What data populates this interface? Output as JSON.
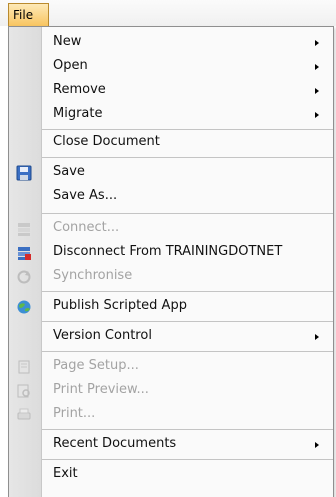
{
  "menubar": {
    "file_label": "File"
  },
  "menu": {
    "items": [
      {
        "label": "New",
        "submenu": true
      },
      {
        "label": "Open",
        "submenu": true
      },
      {
        "label": "Remove",
        "submenu": true
      },
      {
        "label": "Migrate",
        "submenu": true
      },
      {
        "label": "Close Document"
      },
      {
        "label": "Save",
        "icon": "save-icon"
      },
      {
        "label": "Save As..."
      },
      {
        "label": "Connect...",
        "icon": "connect-icon",
        "disabled": true
      },
      {
        "label": "Disconnect From TRAININGDOTNET",
        "icon": "disconnect-icon"
      },
      {
        "label": "Synchronise",
        "icon": "sync-icon",
        "disabled": true
      },
      {
        "label": "Publish Scripted App",
        "icon": "publish-icon"
      },
      {
        "label": "Version Control",
        "submenu": true
      },
      {
        "label": "Page Setup...",
        "icon": "page-setup-icon",
        "disabled": true
      },
      {
        "label": "Print Preview...",
        "icon": "print-preview-icon",
        "disabled": true
      },
      {
        "label": "Print...",
        "icon": "print-icon",
        "disabled": true
      },
      {
        "label": "Recent Documents",
        "submenu": true
      },
      {
        "label": "Exit"
      }
    ]
  }
}
